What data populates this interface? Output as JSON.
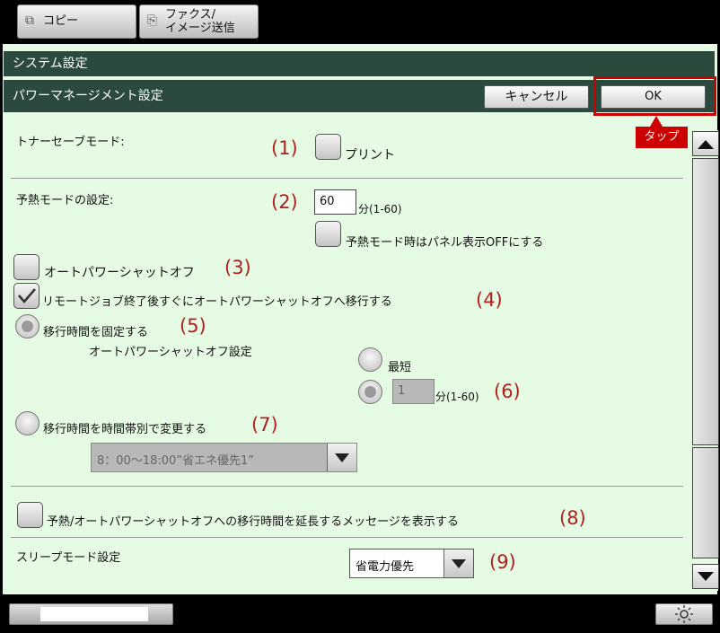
{
  "tabs": [
    {
      "icon": "copy-icon",
      "label": "コピー"
    },
    {
      "icon": "fax-icon",
      "label": "ファクス/\nイメージ送信"
    }
  ],
  "header": {
    "section": "システム設定",
    "title": "パワーマネージメント設定"
  },
  "buttons": {
    "cancel": "キャンセル",
    "ok": "OK",
    "tap_tooltip": "タップ"
  },
  "settings": {
    "toner_save": {
      "label": "トナーセーブモード:",
      "number": "(1)",
      "print_label": "プリント"
    },
    "preheat": {
      "label": "予熱モードの設定:",
      "number": "(2)",
      "value": "60",
      "unit": "分(1-60)",
      "panel_off_label": "予熱モード時はパネル表示OFFにする"
    },
    "auto_power_off": {
      "label": "オートパワーシャットオフ",
      "number": "(3)"
    },
    "remote_job": {
      "label": "リモートジョブ終了後すぐにオートパワーシャットオフへ移行する",
      "number": "(4)",
      "checked": true
    },
    "fixed_time": {
      "label": "移行時間を固定する",
      "number": "(5)",
      "sub_label": "オートパワーシャットオフ設定",
      "shortest_label": "最短",
      "minutes_value": "1",
      "unit": "分(1-60)",
      "minutes_number": "(6)"
    },
    "time_zone": {
      "label": "移行時間を時間帯別で変更する",
      "number": "(7)",
      "select_value": "8：00～18:00”省エネ優先1”"
    },
    "extend_message": {
      "label": "予熱/オートパワーシャットオフへの移行時間を延長するメッセージを表示する",
      "number": "(8)"
    },
    "sleep_mode": {
      "label": "スリープモード設定",
      "select_value": "省電力優先",
      "number": "(9)"
    }
  },
  "colors": {
    "panel_bg": "#e6fbe4",
    "titlebar_bg": "#2b4a3d",
    "accent_red": "#b0201c",
    "highlight": "#cc0000"
  }
}
